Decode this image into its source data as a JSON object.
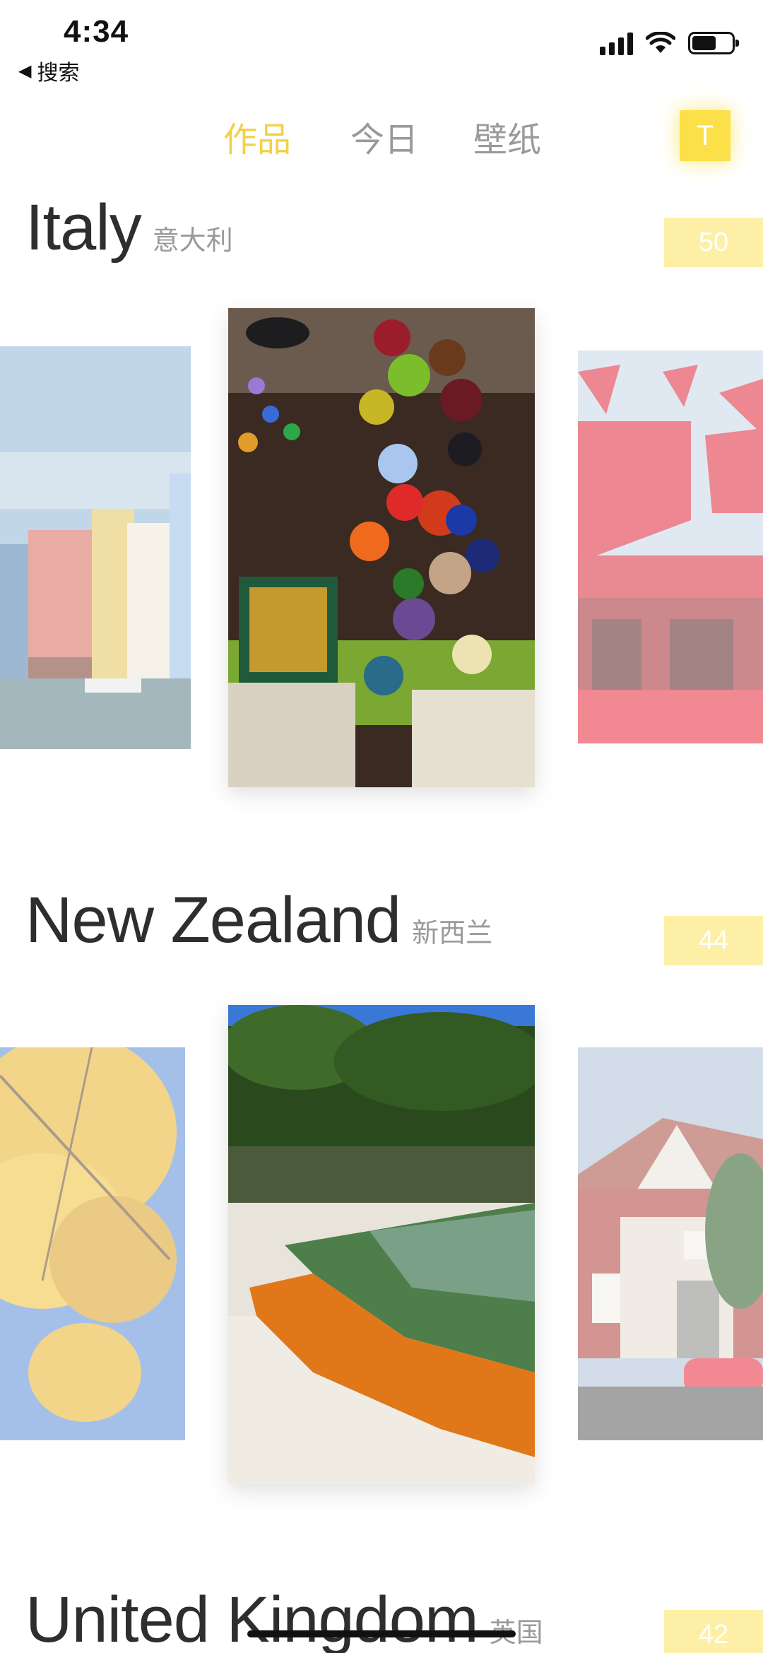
{
  "status": {
    "time": "4:34",
    "back_label": "搜索"
  },
  "nav": {
    "tabs": [
      {
        "label": "作品",
        "active": true
      },
      {
        "label": "今日",
        "active": false
      },
      {
        "label": "壁纸",
        "active": false
      }
    ],
    "avatar_letter": "T",
    "accent_color": "#f2d14a"
  },
  "sections": [
    {
      "title": "Italy",
      "subtitle": "意大利",
      "count": "50",
      "cards": [
        {
          "subject": "burano-canal-houses"
        },
        {
          "subject": "glass-balloons-shop"
        },
        {
          "subject": "venice-film-festival"
        }
      ]
    },
    {
      "title": "New Zealand",
      "subtitle": "新西兰",
      "count": "44",
      "cards": [
        {
          "subject": "autumn-yellow-tree"
        },
        {
          "subject": "champagne-pool-geothermal"
        },
        {
          "subject": "brick-house-red-car"
        }
      ]
    },
    {
      "title": "United Kingdom",
      "subtitle": "英国",
      "count": "42"
    }
  ]
}
